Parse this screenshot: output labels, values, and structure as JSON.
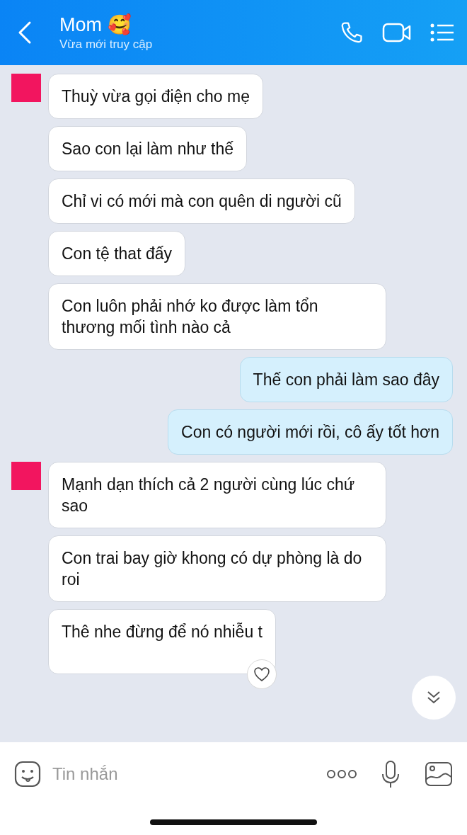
{
  "header": {
    "title": "Mom 🥰",
    "status": "Vừa mới truy cập"
  },
  "messages": [
    {
      "kind": "incoming",
      "avatar": true,
      "text": "Thuỳ vừa gọi điện cho mẹ"
    },
    {
      "kind": "incoming",
      "avatar": false,
      "text": "Sao con lại làm như thế"
    },
    {
      "kind": "incoming",
      "avatar": false,
      "text": "Chỉ vi có mới mà con quên di người cũ"
    },
    {
      "kind": "incoming",
      "avatar": false,
      "text": "Con tệ that đấy"
    },
    {
      "kind": "incoming",
      "avatar": false,
      "text": "Con luôn phải nhớ ko được làm tổn thương mối tình nào cả"
    },
    {
      "kind": "outgoing",
      "avatar": false,
      "text": "Thế con phải làm sao đây"
    },
    {
      "kind": "outgoing",
      "avatar": false,
      "text": "Con có người mới rồi, cô ấy tốt hơn"
    },
    {
      "kind": "incoming",
      "avatar": true,
      "text": "Mạnh dạn thích cả 2 người cùng lúc chứ sao"
    },
    {
      "kind": "incoming",
      "avatar": false,
      "text": "Con trai bay giờ khong có dự phòng là do roi"
    },
    {
      "kind": "incoming",
      "avatar": false,
      "text": "Thê nhe đừng để nó nhiễu t",
      "reaction_button": true
    }
  ],
  "composer": {
    "placeholder": "Tin nhắn"
  }
}
